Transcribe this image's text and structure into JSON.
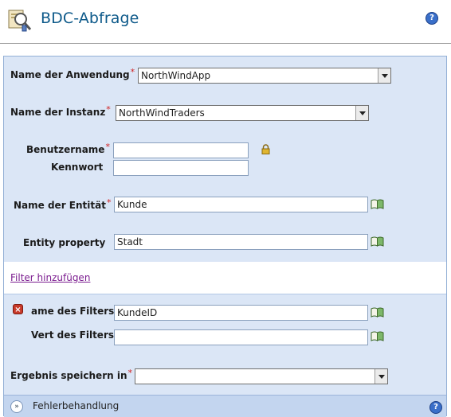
{
  "header": {
    "title": "BDC-Abfrage",
    "help": "?"
  },
  "form": {
    "application": {
      "label": "Name der Anwendung",
      "required": "*",
      "value": "NorthWindApp"
    },
    "instance": {
      "label": "Name der Instanz",
      "required": "*",
      "value": "NorthWindTraders"
    },
    "username": {
      "label": "Benutzername",
      "required": "*",
      "value": ""
    },
    "password": {
      "label": "Kennwort",
      "value": ""
    },
    "entity": {
      "label": "Name der Entität",
      "required": "*",
      "value": "Kunde"
    },
    "entity_property": {
      "label": "Entity property",
      "value": "Stadt"
    },
    "add_filter": "Filter hinzufügen",
    "filter_name": {
      "label": "ame des Filters",
      "value": "KundeID"
    },
    "filter_value": {
      "label": "Vert des Filters",
      "value": ""
    },
    "save_result": {
      "label": "Ergebnis speichern in",
      "required": "*",
      "value": ""
    }
  },
  "footer": {
    "label": "Fehlerbehandlung",
    "chevron": "»",
    "help": "?"
  },
  "colors": {
    "panel_bg": "#dbe6f6",
    "title": "#0e5a8a",
    "required": "#d12020",
    "link": "#7b1c8f"
  },
  "icons": [
    "search-icon",
    "help-icon",
    "lock-icon",
    "book-icon",
    "remove-icon",
    "chevron-down-icon"
  ]
}
